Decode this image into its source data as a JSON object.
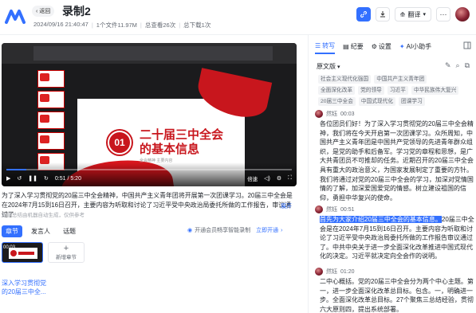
{
  "header": {
    "back_label": "返回",
    "title": "录制2",
    "meta": [
      "2024/09/16 21:40:47",
      "1个文件11.97M",
      "总查看26次",
      "总下载1次"
    ],
    "translate_label": "翻译"
  },
  "video": {
    "slide_number": "01",
    "slide_title": "二十届三中全会的基本信息",
    "slide_sub": "全会精神  主要内容",
    "progress": 0.07,
    "time": "0:51 / 5:20",
    "speed": "倍速"
  },
  "summary": {
    "caption": "为了深入学习贯彻党的20届三中全会精神，中国共产主义青年团将开展第一次团课学习。20届三中全会是在2024年7月15到16日召开，主要内容为听取和讨论了习近平受中央政治局委托所做的工作报告，审议通过了",
    "ai_note": "智能总结由机器自动生成，仅供参考",
    "expand": "展开"
  },
  "tabs": [
    {
      "label": "章节",
      "active": true
    },
    {
      "label": "发言人",
      "active": false
    },
    {
      "label": "话题",
      "active": false
    }
  ],
  "member_tip": {
    "text": "开通会员畅享智能录制",
    "link": "立即开通"
  },
  "chapters": {
    "time": "00:03",
    "add_label": "新增章节",
    "title": "深入学习贯彻党的20届三中全..."
  },
  "right_panel": {
    "tabs": [
      "转写",
      "纪要",
      "设置",
      "AI小助手"
    ],
    "original_label": "原文版",
    "keywords": [
      "社会主义现代化强国",
      "中国共产主义青年团",
      "全面深化改革",
      "党的领导",
      "习近平",
      "中华民族伟大复兴",
      "20届三中全会",
      "中国式现代化",
      "团课学习"
    ],
    "segments": [
      {
        "speaker": "然钰",
        "time": "00:03",
        "text": "各位团员们好！为了深入学习贯彻党的20届三中全会精神，我们将在今天开启第一次团课学习。众所周知，中国共产主义青年团是中国共产党领导的先进青年群众组织，是党的助手和后备军。学习党的章程和思想，是广大共青团员不可推却的任务。近期召开的20届三中全会具有重大的政治意义，为国家发展制定了重要的方针。我们将通过对党的20届三中全会的学习，加深对党情国情的了解，加深爱国爱党的情感。树立建设祖国的信仰，勇担中华复兴的使命。"
      },
      {
        "speaker": "然钰",
        "time": "00:51",
        "highlight": "首先为大家介绍20届三中全会的基本信息。",
        "text": "20届三中全会是在2024年7月15到16日召开。主要内容为听取和讨论了习近平受中央政治局委托所做的工作报告审议通过了。中共中央关于进一步全面深化改革推进中国式现代化的决定。习近平就决定向全会作的说明。"
      },
      {
        "speaker": "然钰",
        "time": "01:20",
        "text": "二中心概括。党的20届三中全会分为两个中心主题。第一，进一步全面深化改革总目标。包含。一，明确进一步。全面深化改革总目标。27个聚焦三总结经验，贯彻六大原则四，提出系统部署。"
      }
    ]
  },
  "colors": {
    "accent": "#3370ff",
    "slide_red": "#c8161d"
  }
}
